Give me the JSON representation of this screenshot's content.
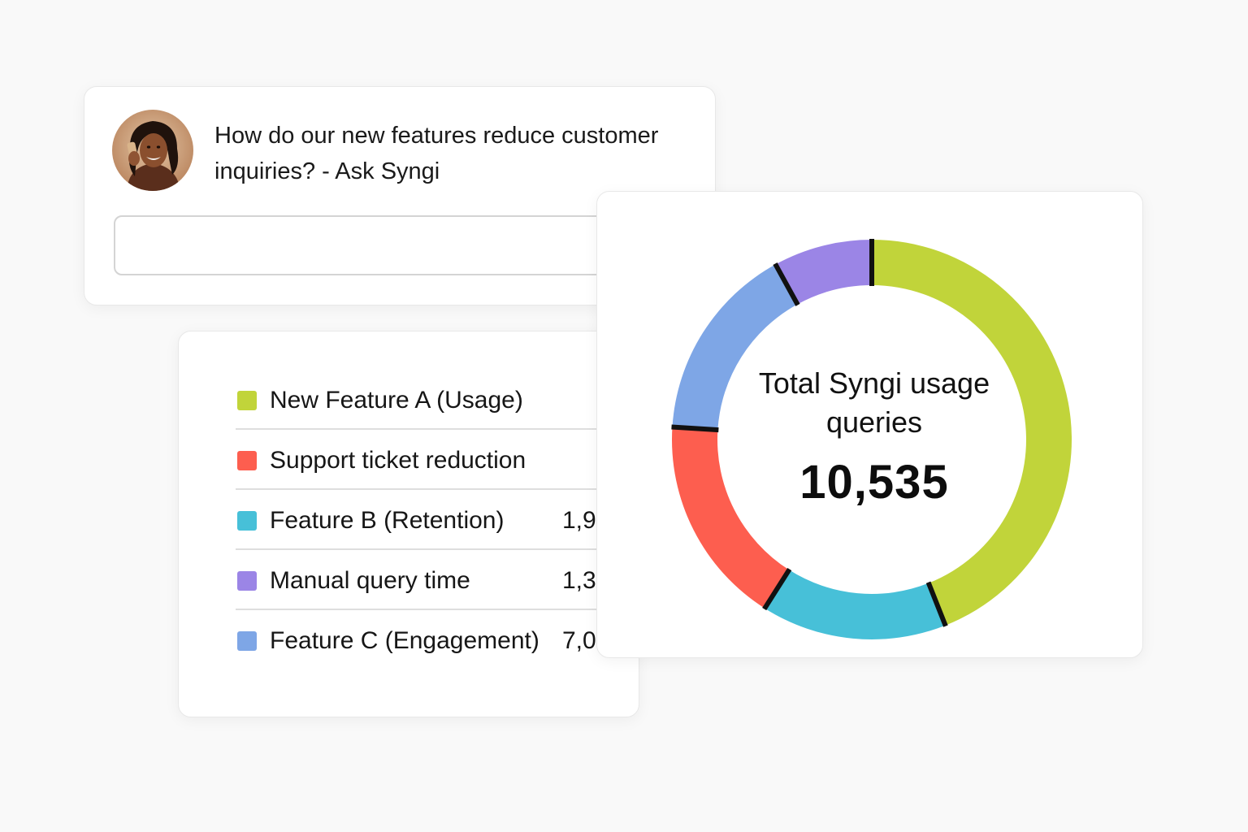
{
  "ask": {
    "question": "How do our new features reduce customer inquiries? - Ask Syngi",
    "input_value": ""
  },
  "legend": {
    "items": [
      {
        "label": "New Feature A (Usage)",
        "value": "",
        "color": "#c1d43a"
      },
      {
        "label": "Support ticket reduction",
        "value": "",
        "color": "#fd5e4f"
      },
      {
        "label": "Feature B (Retention)",
        "value": "1,9",
        "color": "#47c0d8"
      },
      {
        "label": "Manual query time",
        "value": "1,3",
        "color": "#9b85e6"
      },
      {
        "label": "Feature C (Engagement)",
        "value": "7,0",
        "color": "#7ea6e6"
      }
    ]
  },
  "chart_data": {
    "type": "pie",
    "donut": true,
    "center_label": "Total Syngi usage queries",
    "center_value": "10,535",
    "categories": [
      "New Feature A (Usage)",
      "Feature B (Retention)",
      "Support ticket reduction",
      "Feature C (Engagement)",
      "Manual query time"
    ],
    "values": [
      44,
      15,
      17,
      16,
      8
    ],
    "colors": [
      "#c1d43a",
      "#47c0d8",
      "#fd5e4f",
      "#7ea6e6",
      "#9b85e6"
    ],
    "separator_color": "#111111"
  }
}
